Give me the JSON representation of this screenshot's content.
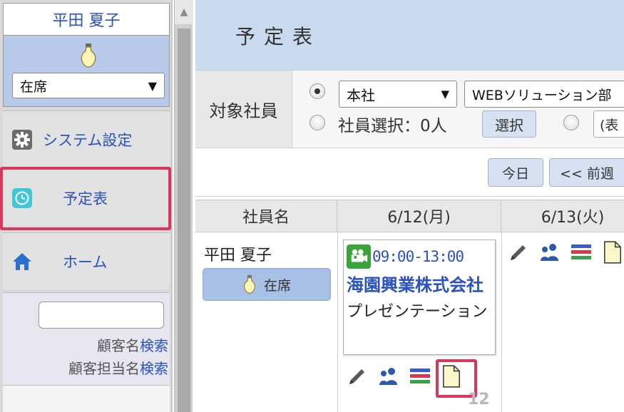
{
  "sidebar": {
    "user_name": "平田 夏子",
    "status_value": "在席",
    "menu": {
      "system": "システム設定",
      "schedule": "予定表",
      "home": "ホーム"
    },
    "search": {
      "customer_prefix": "顧客名",
      "customer_link": "検索",
      "contact_prefix": "顧客担当名",
      "contact_link": "検索"
    }
  },
  "page": {
    "title": "予定表",
    "filter": {
      "label": "対象社員",
      "office": "本社",
      "department": "WEBソリューション部",
      "employee_select_text": "社員選択：0人",
      "select_button": "選択",
      "display_select": "(表"
    },
    "nav": {
      "today": "今日",
      "prev_week": "<< 前週"
    },
    "table": {
      "headers": [
        "社員名",
        "6/12(月)",
        "6/13(火)"
      ],
      "employee": {
        "name": "平田 夏子",
        "status": "在席"
      },
      "event": {
        "time": "09:00-13:00",
        "company": "海園興業株式会社",
        "title": "プレゼンテーション"
      },
      "day_number": "12"
    }
  },
  "colors": {
    "accent_blue": "#2a52be",
    "highlight_red": "#d6375a",
    "header_bg": "#c9d9ee",
    "status_bg": "#a9c1e6"
  },
  "icons": [
    "bulb-icon",
    "gear-icon",
    "clock-icon",
    "home-icon",
    "video-camera-icon",
    "pencil-icon",
    "people-icon",
    "list-icon",
    "memo-icon"
  ]
}
